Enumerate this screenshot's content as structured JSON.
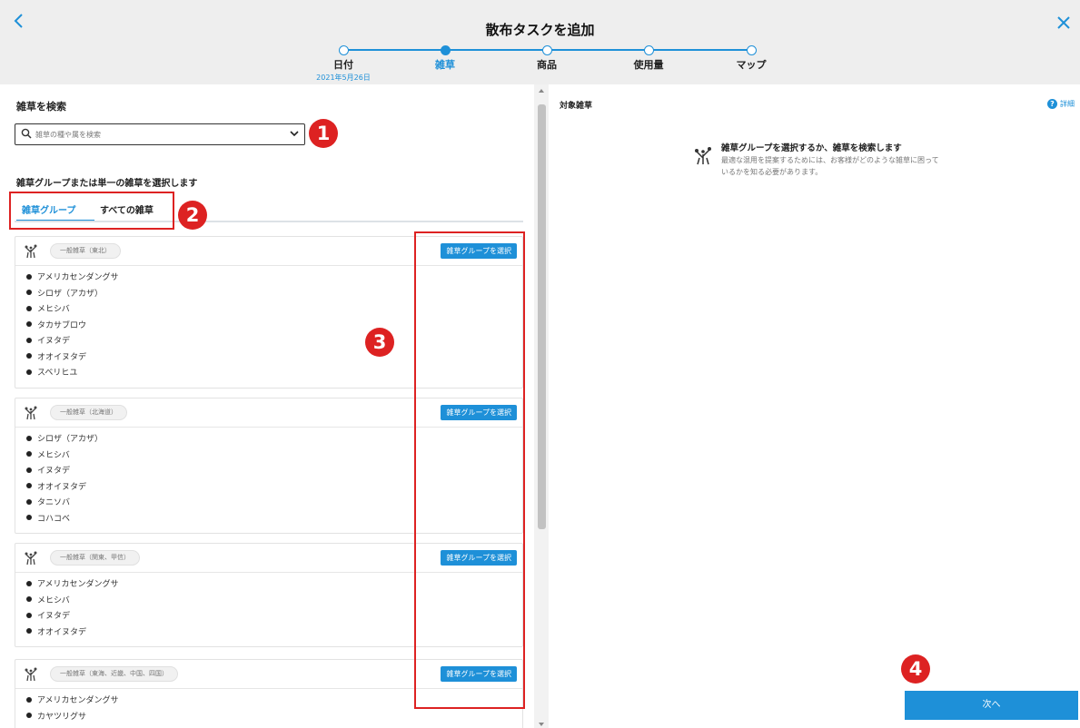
{
  "header": {
    "title": "散布タスクを追加",
    "back_icon": "chevron-left-icon",
    "close_icon": "close-icon"
  },
  "stepper": {
    "steps": [
      {
        "label": "日付",
        "sub": "2021年5月26日",
        "state": "done"
      },
      {
        "label": "雑草",
        "state": "active"
      },
      {
        "label": "商品",
        "state": "todo"
      },
      {
        "label": "使用量",
        "state": "todo"
      },
      {
        "label": "マップ",
        "state": "todo"
      }
    ]
  },
  "left": {
    "search_heading": "雑草を検索",
    "search_placeholder": "雑草の種や属を検索",
    "select_heading": "雑草グループまたは単一の雑草を選択します",
    "tabs": [
      {
        "label": "雑草グループ",
        "active": true
      },
      {
        "label": "すべての雑草",
        "active": false
      }
    ],
    "groups": [
      {
        "name": "一般雑草（東北）",
        "button": "雑草グループを選択",
        "weeds": [
          "アメリカセンダングサ",
          "シロザ（アカザ）",
          "メヒシバ",
          "タカサブロウ",
          "イヌタデ",
          "オオイヌタデ",
          "スベリヒユ"
        ]
      },
      {
        "name": "一般雑草（北海道）",
        "button": "雑草グループを選択",
        "weeds": [
          "シロザ（アカザ）",
          "メヒシバ",
          "イヌタデ",
          "オオイヌタデ",
          "タニソバ",
          "コハコベ"
        ]
      },
      {
        "name": "一般雑草（関東、甲信）",
        "button": "雑草グループを選択",
        "weeds": [
          "アメリカセンダングサ",
          "メヒシバ",
          "イヌタデ",
          "オオイヌタデ"
        ]
      },
      {
        "name": "一般雑草（東海、近畿、中国、四国）",
        "button": "雑草グループを選択",
        "weeds": [
          "アメリカセンダングサ",
          "カヤツリグサ"
        ]
      }
    ]
  },
  "right": {
    "heading": "対象雑草",
    "details": "詳細",
    "empty_title": "雑草グループを選択するか、雑草を検索します",
    "empty_desc": "最適な混用を提案するためには、お客様がどのような雑草に困っているかを知る必要があります。",
    "next_label": "次へ"
  },
  "annotations": [
    "1",
    "2",
    "3",
    "4"
  ],
  "colors": {
    "accent": "#1e90d8",
    "annotation_red": "#dd2222",
    "header_bg": "#eeeeee"
  }
}
